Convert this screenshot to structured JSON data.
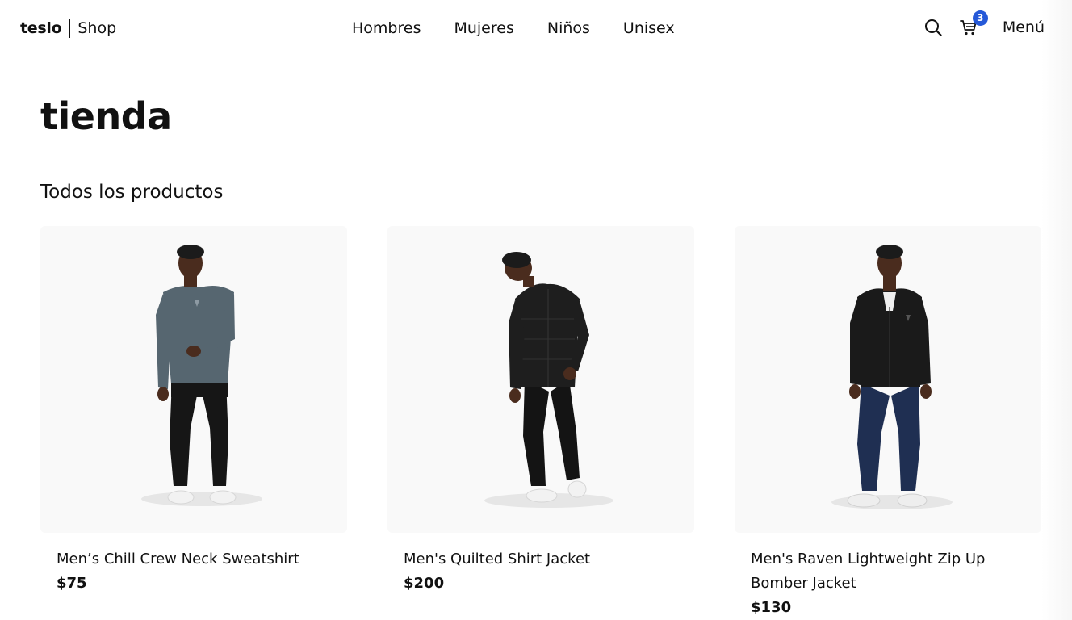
{
  "header": {
    "brand_name": "teslo",
    "brand_suffix": "Shop",
    "nav": [
      {
        "label": "Hombres"
      },
      {
        "label": "Mujeres"
      },
      {
        "label": "Niños"
      },
      {
        "label": "Unisex"
      }
    ],
    "search_icon": "search-icon",
    "cart_icon": "cart-icon",
    "cart_count": "3",
    "menu_label": "Menú",
    "accent_color": "#2559d8"
  },
  "main": {
    "title": "tienda",
    "subtitle": "Todos los productos",
    "products": [
      {
        "title": "Men’s Chill Crew Neck Sweatshirt",
        "price": "$75",
        "image": "model in gray crew neck sweatshirt and black pants"
      },
      {
        "title": "Men's Quilted Shirt Jacket",
        "price": "$200",
        "image": "model in black quilted shirt jacket and black pants"
      },
      {
        "title": "Men's Raven Lightweight Zip Up Bomber Jacket",
        "price": "$130",
        "image": "model in black zip up bomber jacket and blue jeans"
      }
    ]
  }
}
